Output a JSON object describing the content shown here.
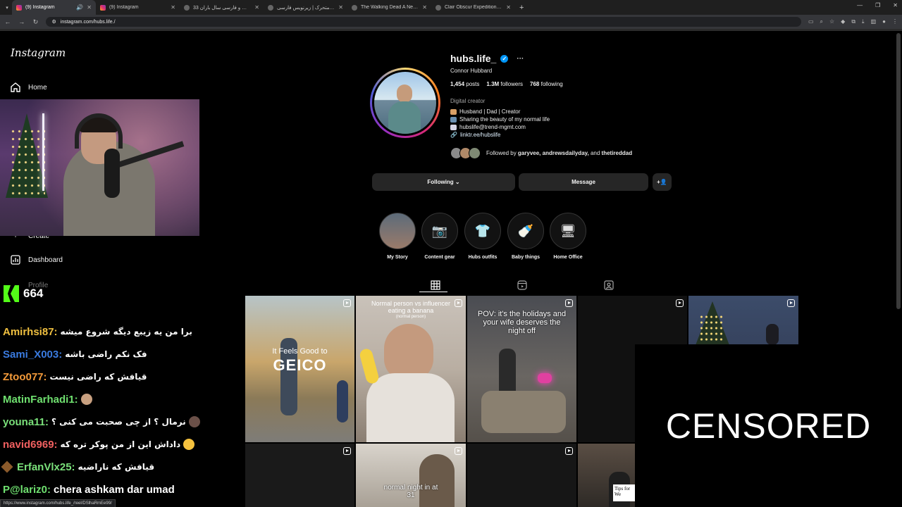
{
  "browser": {
    "tabs": [
      {
        "label": "(9) Instagram",
        "icon": "instagram",
        "active": true
      },
      {
        "label": "(9) Instagram",
        "icon": "instagram",
        "active": false
      },
      {
        "label": "زیرنویس و فارسی سال باران 33 ...",
        "icon": "generic",
        "active": false
      },
      {
        "label": "مردگان متحرک | زیرنویس فارسی ...",
        "icon": "generic",
        "active": false
      },
      {
        "label": "The Walking Dead A New Fron...",
        "icon": "generic",
        "active": false
      },
      {
        "label": "Clair Obscur Expedition 33 [TY...",
        "icon": "generic",
        "active": false
      }
    ],
    "url": "instagram.com/hubs.life./",
    "status_url": "https://www.instagram.com/hubs.life_/reel/DSlhaRmEe99/"
  },
  "sidebar": {
    "logo": "Instagram",
    "home": "Home",
    "create": "Create",
    "dashboard": "Dashboard",
    "profile": "Profile"
  },
  "stream": {
    "viewer_count": "664",
    "chat": [
      {
        "user": "Amirhsi87:",
        "msg": "برا من یه زیبع دیگه شروع میشه",
        "color": "#f0c040"
      },
      {
        "user": "Sami_X003:",
        "msg": "فک نکم راضی باشه",
        "color": "#3a7be0"
      },
      {
        "user": "Ztoo077:",
        "msg": "قیافش که راضی نیست",
        "color": "#f39a3a"
      },
      {
        "user": "MatinFarhadi1:",
        "msg": "",
        "color": "#6fe06f"
      },
      {
        "user": "youna11:",
        "msg": "نرمال ؟ از چی صحبت می کنی ؟",
        "color": "#7ae07a"
      },
      {
        "user": "navid6969:",
        "msg": "داداش این از من پوکر تره که",
        "color": "#f06060"
      },
      {
        "user": "ErfanVlx25:",
        "msg": "قیافش که ناراضیه",
        "color": "#7ae07a"
      },
      {
        "user": "P@lariz0:",
        "msg": "chera ashkam dar umad",
        "color": "#6fe06f"
      }
    ]
  },
  "profile": {
    "username": "hubs.life_",
    "full_name": "Connor Hubbard",
    "posts_count": "1,454",
    "posts_label": "posts",
    "followers_count": "1.3M",
    "followers_label": "followers",
    "following_count": "768",
    "following_label": "following",
    "category": "Digital creator",
    "bio": [
      "Husband | Dad | Creator",
      "Sharing the beauty of my normal life",
      "hubslife@trend-mgmt.com"
    ],
    "link": "linktr.ee/hubslife",
    "followed_by_prefix": "Followed by",
    "followed_by_names": "garyvee, andrewsdailyday,",
    "followed_by_and": "and",
    "followed_by_last": "thetireddad",
    "following_button": "Following",
    "message_button": "Message"
  },
  "highlights": [
    "My Story",
    "Content gear",
    "Hubs outfits",
    "Baby things",
    "Home Office"
  ],
  "grid": {
    "t1_text": "It Feels Good to",
    "t1_brand": "GEICO",
    "t2_title": "Normal person vs influencer eating a banana",
    "t2_sub": "(normal person)",
    "t3_text": "POV: it's the holidays and your wife deserves the night off",
    "t7_text": "normal night in at 31",
    "t9_text": "Tips for We"
  },
  "overlay": {
    "censored": "CENSORED"
  },
  "colors": {
    "instagram_blue": "#0095f6",
    "kick_green": "#53fc18",
    "button_bg": "#262626"
  }
}
